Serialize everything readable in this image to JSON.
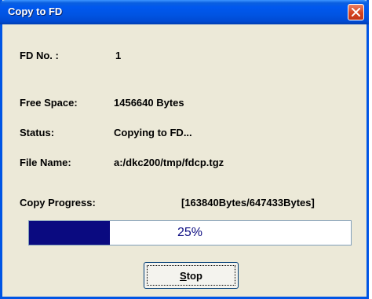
{
  "window": {
    "title": "Copy to FD",
    "close_icon": "close-icon"
  },
  "fields": {
    "fd_no": {
      "label": "FD No. :",
      "value": "1"
    },
    "free_space": {
      "label": "Free Space:",
      "value": "1456640 Bytes"
    },
    "status": {
      "label": "Status:",
      "value": "Copying to FD..."
    },
    "file_name": {
      "label": "File Name:",
      "value": "a:/dkc200/tmp/fdcp.tgz"
    }
  },
  "progress": {
    "label": "Copy Progress:",
    "bytes_text": "[163840Bytes/647433Bytes]",
    "percent_text": "25%",
    "fraction": 0.25
  },
  "buttons": {
    "stop_mnemonic": "S",
    "stop_rest": "top"
  },
  "colors": {
    "titlebar": "#0054e3",
    "dialog_bg": "#ece9d8",
    "progress_fill": "#0a0a80",
    "close_button": "#d4431f"
  }
}
